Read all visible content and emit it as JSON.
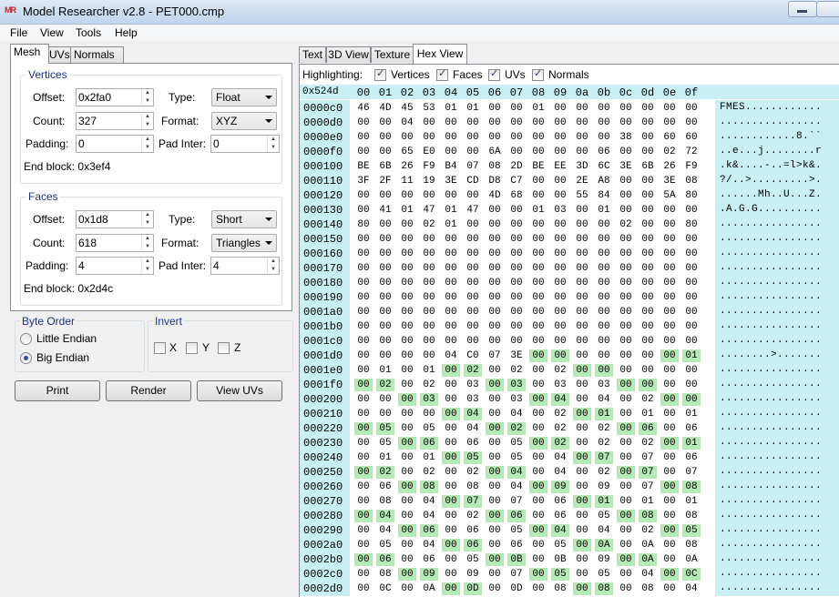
{
  "titlebar": {
    "logo": "MR",
    "title": "Model Researcher v2.8 - PET000.cmp"
  },
  "menu": [
    "File",
    "View",
    "Tools",
    "Help"
  ],
  "left_tabs": [
    "Mesh",
    "UVs",
    "Normals"
  ],
  "vertices": {
    "title": "Vertices",
    "offset_label": "Offset:",
    "offset": "0x2fa0",
    "count_label": "Count:",
    "count": "327",
    "padding_label": "Padding:",
    "padding": "0",
    "type_label": "Type:",
    "type": "Float",
    "format_label": "Format:",
    "format": "XYZ",
    "pad_inter_label": "Pad Inter:",
    "pad_inter": "0",
    "end_block_label": "End block:",
    "end_block": "0x3ef4"
  },
  "faces": {
    "title": "Faces",
    "offset_label": "Offset:",
    "offset": "0x1d8",
    "count_label": "Count:",
    "count": "618",
    "padding_label": "Padding:",
    "padding": "4",
    "type_label": "Type:",
    "type": "Short",
    "format_label": "Format:",
    "format": "Triangles",
    "pad_inter_label": "Pad Inter:",
    "pad_inter": "4",
    "end_block_label": "End block:",
    "end_block": "0x2d4c"
  },
  "byte_order": {
    "title": "Byte Order",
    "little": "Little Endian",
    "big": "Big Endian",
    "selected": "Big Endian"
  },
  "invert": {
    "title": "Invert",
    "x": "X",
    "y": "Y",
    "z": "Z"
  },
  "buttons": {
    "print": "Print",
    "render": "Render",
    "view_uvs": "View UVs"
  },
  "right_tabs": [
    "Text",
    "3D View",
    "Texture",
    "Hex View"
  ],
  "highlighting": {
    "label": "Highlighting:",
    "vertices": "Vertices",
    "faces": "Faces",
    "uvs": "UVs",
    "normals": "Normals"
  },
  "hex": {
    "position": "0x524d",
    "columns": [
      "00",
      "01",
      "02",
      "03",
      "04",
      "05",
      "06",
      "07",
      "08",
      "09",
      "0a",
      "0b",
      "0c",
      "0d",
      "0e",
      "0f"
    ],
    "highlight_color": "#b6e8b8",
    "rows": [
      {
        "addr": "0000c0",
        "bytes": [
          "46",
          "4D",
          "45",
          "53",
          "01",
          "01",
          "00",
          "00",
          "01",
          "00",
          "00",
          "00",
          "00",
          "00",
          "00",
          "00"
        ],
        "hl": [],
        "ascii": "FMES............"
      },
      {
        "addr": "0000d0",
        "bytes": [
          "00",
          "00",
          "04",
          "00",
          "00",
          "00",
          "00",
          "00",
          "00",
          "00",
          "00",
          "00",
          "00",
          "00",
          "00",
          "00"
        ],
        "hl": [],
        "ascii": "................"
      },
      {
        "addr": "0000e0",
        "bytes": [
          "00",
          "00",
          "00",
          "00",
          "00",
          "00",
          "00",
          "00",
          "00",
          "00",
          "00",
          "00",
          "38",
          "00",
          "60",
          "60"
        ],
        "hl": [],
        "ascii": "............8.``"
      },
      {
        "addr": "0000f0",
        "bytes": [
          "00",
          "00",
          "65",
          "E0",
          "00",
          "00",
          "6A",
          "00",
          "00",
          "00",
          "00",
          "06",
          "00",
          "00",
          "02",
          "72"
        ],
        "hl": [],
        "ascii": "..e...j........r"
      },
      {
        "addr": "000100",
        "bytes": [
          "BE",
          "6B",
          "26",
          "F9",
          "B4",
          "07",
          "08",
          "2D",
          "BE",
          "EE",
          "3D",
          "6C",
          "3E",
          "6B",
          "26",
          "F9"
        ],
        "hl": [],
        "ascii": ".k&....-..=l>k&."
      },
      {
        "addr": "000110",
        "bytes": [
          "3F",
          "2F",
          "11",
          "19",
          "3E",
          "CD",
          "D8",
          "C7",
          "00",
          "00",
          "2E",
          "A8",
          "00",
          "00",
          "3E",
          "08"
        ],
        "hl": [],
        "ascii": "?/..>.........>."
      },
      {
        "addr": "000120",
        "bytes": [
          "00",
          "00",
          "00",
          "00",
          "00",
          "00",
          "4D",
          "68",
          "00",
          "00",
          "55",
          "84",
          "00",
          "00",
          "5A",
          "80"
        ],
        "hl": [],
        "ascii": "......Mh..U...Z."
      },
      {
        "addr": "000130",
        "bytes": [
          "00",
          "41",
          "01",
          "47",
          "01",
          "47",
          "00",
          "00",
          "01",
          "03",
          "00",
          "01",
          "00",
          "00",
          "00",
          "00"
        ],
        "hl": [],
        "ascii": ".A.G.G.........."
      },
      {
        "addr": "000140",
        "bytes": [
          "80",
          "00",
          "00",
          "02",
          "01",
          "00",
          "00",
          "00",
          "00",
          "00",
          "00",
          "00",
          "02",
          "00",
          "00",
          "80"
        ],
        "hl": [],
        "ascii": "................"
      },
      {
        "addr": "000150",
        "bytes": [
          "00",
          "00",
          "00",
          "00",
          "00",
          "00",
          "00",
          "00",
          "00",
          "00",
          "00",
          "00",
          "00",
          "00",
          "00",
          "00"
        ],
        "hl": [],
        "ascii": "................"
      },
      {
        "addr": "000160",
        "bytes": [
          "00",
          "00",
          "00",
          "00",
          "00",
          "00",
          "00",
          "00",
          "00",
          "00",
          "00",
          "00",
          "00",
          "00",
          "00",
          "00"
        ],
        "hl": [],
        "ascii": "................"
      },
      {
        "addr": "000170",
        "bytes": [
          "00",
          "00",
          "00",
          "00",
          "00",
          "00",
          "00",
          "00",
          "00",
          "00",
          "00",
          "00",
          "00",
          "00",
          "00",
          "00"
        ],
        "hl": [],
        "ascii": "................"
      },
      {
        "addr": "000180",
        "bytes": [
          "00",
          "00",
          "00",
          "00",
          "00",
          "00",
          "00",
          "00",
          "00",
          "00",
          "00",
          "00",
          "00",
          "00",
          "00",
          "00"
        ],
        "hl": [],
        "ascii": "................"
      },
      {
        "addr": "000190",
        "bytes": [
          "00",
          "00",
          "00",
          "00",
          "00",
          "00",
          "00",
          "00",
          "00",
          "00",
          "00",
          "00",
          "00",
          "00",
          "00",
          "00"
        ],
        "hl": [],
        "ascii": "................"
      },
      {
        "addr": "0001a0",
        "bytes": [
          "00",
          "00",
          "00",
          "00",
          "00",
          "00",
          "00",
          "00",
          "00",
          "00",
          "00",
          "00",
          "00",
          "00",
          "00",
          "00"
        ],
        "hl": [],
        "ascii": "................"
      },
      {
        "addr": "0001b0",
        "bytes": [
          "00",
          "00",
          "00",
          "00",
          "00",
          "00",
          "00",
          "00",
          "00",
          "00",
          "00",
          "00",
          "00",
          "00",
          "00",
          "00"
        ],
        "hl": [],
        "ascii": "................"
      },
      {
        "addr": "0001c0",
        "bytes": [
          "00",
          "00",
          "00",
          "00",
          "00",
          "00",
          "00",
          "00",
          "00",
          "00",
          "00",
          "00",
          "00",
          "00",
          "00",
          "00"
        ],
        "hl": [],
        "ascii": "................"
      },
      {
        "addr": "0001d0",
        "bytes": [
          "00",
          "00",
          "00",
          "00",
          "04",
          "C0",
          "07",
          "3E",
          "00",
          "00",
          "00",
          "00",
          "00",
          "00",
          "00",
          "01"
        ],
        "hl": [
          8,
          9,
          14,
          15
        ],
        "ascii": "........>......."
      },
      {
        "addr": "0001e0",
        "bytes": [
          "00",
          "01",
          "00",
          "01",
          "00",
          "02",
          "00",
          "02",
          "00",
          "02",
          "00",
          "00",
          "00",
          "00",
          "00",
          "00"
        ],
        "hl": [
          4,
          5,
          10,
          11
        ],
        "ascii": "................"
      },
      {
        "addr": "0001f0",
        "bytes": [
          "00",
          "02",
          "00",
          "02",
          "00",
          "03",
          "00",
          "03",
          "00",
          "03",
          "00",
          "03",
          "00",
          "00",
          "00",
          "00"
        ],
        "hl": [
          0,
          1,
          6,
          7,
          12,
          13
        ],
        "ascii": "................"
      },
      {
        "addr": "000200",
        "bytes": [
          "00",
          "00",
          "00",
          "03",
          "00",
          "03",
          "00",
          "03",
          "00",
          "04",
          "00",
          "04",
          "00",
          "02",
          "00",
          "00"
        ],
        "hl": [
          2,
          3,
          8,
          9,
          14,
          15
        ],
        "ascii": "................"
      },
      {
        "addr": "000210",
        "bytes": [
          "00",
          "00",
          "00",
          "00",
          "00",
          "04",
          "00",
          "04",
          "00",
          "02",
          "00",
          "01",
          "00",
          "01",
          "00",
          "01"
        ],
        "hl": [
          4,
          5,
          10,
          11
        ],
        "ascii": "................"
      },
      {
        "addr": "000220",
        "bytes": [
          "00",
          "05",
          "00",
          "05",
          "00",
          "04",
          "00",
          "02",
          "00",
          "02",
          "00",
          "02",
          "00",
          "06",
          "00",
          "06"
        ],
        "hl": [
          0,
          1,
          6,
          7,
          12,
          13
        ],
        "ascii": "................"
      },
      {
        "addr": "000230",
        "bytes": [
          "00",
          "05",
          "00",
          "06",
          "00",
          "06",
          "00",
          "05",
          "00",
          "02",
          "00",
          "02",
          "00",
          "02",
          "00",
          "01"
        ],
        "hl": [
          2,
          3,
          8,
          9,
          14,
          15
        ],
        "ascii": "................"
      },
      {
        "addr": "000240",
        "bytes": [
          "00",
          "01",
          "00",
          "01",
          "00",
          "05",
          "00",
          "05",
          "00",
          "04",
          "00",
          "07",
          "00",
          "07",
          "00",
          "06"
        ],
        "hl": [
          4,
          5,
          10,
          11
        ],
        "ascii": "................"
      },
      {
        "addr": "000250",
        "bytes": [
          "00",
          "02",
          "00",
          "02",
          "00",
          "02",
          "00",
          "04",
          "00",
          "04",
          "00",
          "02",
          "00",
          "07",
          "00",
          "07"
        ],
        "hl": [
          0,
          1,
          6,
          7,
          12,
          13
        ],
        "ascii": "................"
      },
      {
        "addr": "000260",
        "bytes": [
          "00",
          "06",
          "00",
          "08",
          "00",
          "08",
          "00",
          "04",
          "00",
          "09",
          "00",
          "09",
          "00",
          "07",
          "00",
          "08"
        ],
        "hl": [
          2,
          3,
          8,
          9,
          14,
          15
        ],
        "ascii": "................"
      },
      {
        "addr": "000270",
        "bytes": [
          "00",
          "08",
          "00",
          "04",
          "00",
          "07",
          "00",
          "07",
          "00",
          "06",
          "00",
          "01",
          "00",
          "01",
          "00",
          "01"
        ],
        "hl": [
          4,
          5,
          10,
          11
        ],
        "ascii": "................"
      },
      {
        "addr": "000280",
        "bytes": [
          "00",
          "04",
          "00",
          "04",
          "00",
          "02",
          "00",
          "06",
          "00",
          "06",
          "00",
          "05",
          "00",
          "08",
          "00",
          "08"
        ],
        "hl": [
          0,
          1,
          6,
          7,
          12,
          13
        ],
        "ascii": "................"
      },
      {
        "addr": "000290",
        "bytes": [
          "00",
          "04",
          "00",
          "06",
          "00",
          "06",
          "00",
          "05",
          "00",
          "04",
          "00",
          "04",
          "00",
          "02",
          "00",
          "05"
        ],
        "hl": [
          2,
          3,
          8,
          9,
          14,
          15
        ],
        "ascii": "................"
      },
      {
        "addr": "0002a0",
        "bytes": [
          "00",
          "05",
          "00",
          "04",
          "00",
          "06",
          "00",
          "06",
          "00",
          "05",
          "00",
          "0A",
          "00",
          "0A",
          "00",
          "08"
        ],
        "hl": [
          4,
          5,
          10,
          11
        ],
        "ascii": "................"
      },
      {
        "addr": "0002b0",
        "bytes": [
          "00",
          "06",
          "00",
          "06",
          "00",
          "05",
          "00",
          "0B",
          "00",
          "0B",
          "00",
          "09",
          "00",
          "0A",
          "00",
          "0A"
        ],
        "hl": [
          0,
          1,
          6,
          7,
          12,
          13
        ],
        "ascii": "................"
      },
      {
        "addr": "0002c0",
        "bytes": [
          "00",
          "08",
          "00",
          "09",
          "00",
          "09",
          "00",
          "07",
          "00",
          "05",
          "00",
          "05",
          "00",
          "04",
          "00",
          "0C"
        ],
        "hl": [
          2,
          3,
          8,
          9,
          14,
          15
        ],
        "ascii": "................"
      },
      {
        "addr": "0002d0",
        "bytes": [
          "00",
          "0C",
          "00",
          "0A",
          "00",
          "0D",
          "00",
          "0D",
          "00",
          "08",
          "00",
          "08",
          "00",
          "08",
          "00",
          "04"
        ],
        "hl": [
          4,
          5,
          10,
          11
        ],
        "ascii": "................"
      }
    ]
  }
}
